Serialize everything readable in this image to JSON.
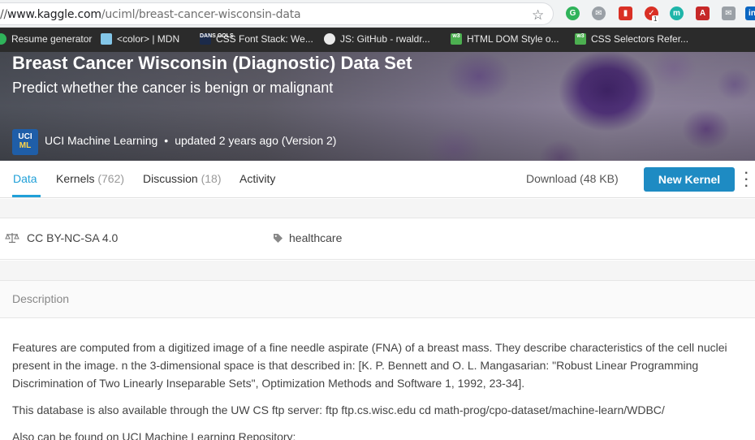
{
  "browser": {
    "url_prefix": "//",
    "url_host": "www.kaggle.com",
    "url_path": "/uciml/breast-cancer-wisconsin-data",
    "extension_badge": "1",
    "bookmarks": [
      {
        "label": "Resume generator",
        "icon": "resume-icon"
      },
      {
        "label": "<color> | MDN",
        "icon": "mdn-icon"
      },
      {
        "label": "CSS Font Stack: We...",
        "icon": "font-stack-icon",
        "icon_text": "DANS OOLS"
      },
      {
        "label": "JS: GitHub - rwaldr...",
        "icon": "github-icon"
      },
      {
        "label": "HTML DOM Style o...",
        "icon": "w3schools-icon",
        "icon_text": "w3"
      },
      {
        "label": "CSS Selectors Refer...",
        "icon": "w3schools-icon",
        "icon_text": "w3"
      }
    ]
  },
  "dataset": {
    "title": "Breast Cancer Wisconsin (Diagnostic) Data Set",
    "subtitle": "Predict whether the cancer is benign or malignant",
    "owner_logo_top": "UCI",
    "owner_logo_bottom": "ML",
    "owner": "UCI Machine Learning",
    "separator": "•",
    "updated": "updated 2 years ago (Version 2)"
  },
  "tabs": [
    {
      "label": "Data",
      "count": ""
    },
    {
      "label": "Kernels",
      "count": "(762)"
    },
    {
      "label": "Discussion",
      "count": "(18)"
    },
    {
      "label": "Activity",
      "count": ""
    }
  ],
  "actions": {
    "download": "Download (48 KB)",
    "new_kernel": "New Kernel"
  },
  "meta": {
    "license": "CC BY-NC-SA 4.0",
    "tag": "healthcare"
  },
  "description": {
    "heading": "Description",
    "paragraphs": [
      "Features are computed from a digitized image of a fine needle aspirate (FNA) of a breast mass. They describe characteristics of the cell nuclei present in the image. n the 3-dimensional space is that described in: [K. P. Bennett and O. L. Mangasarian: \"Robust Linear Programming Discrimination of Two Linearly Inseparable Sets\", Optimization Methods and Software 1, 1992, 23-34].",
      "This database is also available through the UW CS ftp server: ftp ftp.cs.wisc.edu cd math-prog/cpo-dataset/machine-learn/WDBC/",
      "Also can be found on UCI Machine Learning Repository:"
    ]
  },
  "colors": {
    "accent": "#20a0d8",
    "button": "#1e8bc3"
  }
}
